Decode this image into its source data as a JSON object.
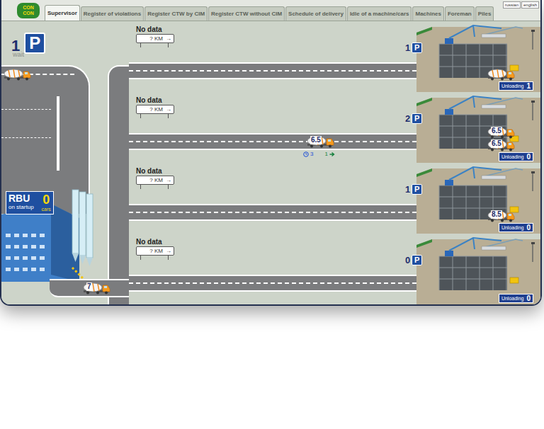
{
  "logo": [
    "CON",
    "CON"
  ],
  "tabs": [
    {
      "label": "Supervisor",
      "selected": true
    },
    {
      "label": "Register of violations",
      "selected": false
    },
    {
      "label": "Register CTW by CIM",
      "selected": false
    },
    {
      "label": "Register CTW without CIM",
      "selected": false
    },
    {
      "label": "Schedule of delivery",
      "selected": false
    },
    {
      "label": "Idle of a machine/cars",
      "selected": false
    },
    {
      "label": "Machines",
      "selected": false
    },
    {
      "label": "Foreman",
      "selected": false
    },
    {
      "label": "Piles",
      "selected": false
    }
  ],
  "languages": [
    "russian",
    "english"
  ],
  "parking": {
    "count": "1",
    "icon": "P",
    "label": "wait",
    "trucks": [
      {
        "load": null
      }
    ]
  },
  "plant": {
    "name": "RBU",
    "status": "on startup",
    "count": "0",
    "unit": "cars",
    "trucks": [
      {
        "load": "7"
      }
    ]
  },
  "lanes": [
    {
      "sign": {
        "title": "No data",
        "distance": "? KM",
        "arrow": "→"
      },
      "road_trucks": [],
      "site": {
        "parked": "1",
        "icon": "P",
        "unloading_label": "Unloading",
        "unloading": "1",
        "trucks": [
          {
            "load": null
          }
        ]
      }
    },
    {
      "sign": {
        "title": "No data",
        "distance": "? KM",
        "arrow": "→"
      },
      "road_trucks": [
        {
          "load": "6.5",
          "wait": "3",
          "queue": "1"
        }
      ],
      "site": {
        "parked": "2",
        "icon": "P",
        "unloading_label": "Unloading",
        "unloading": "0",
        "trucks": [
          {
            "load": "6.5"
          },
          {
            "load": "6.5"
          }
        ]
      }
    },
    {
      "sign": {
        "title": "No data",
        "distance": "? KM",
        "arrow": "→"
      },
      "road_trucks": [],
      "site": {
        "parked": "1",
        "icon": "P",
        "unloading_label": "Unloading",
        "unloading": "0",
        "trucks": [
          {
            "load": "8.5"
          }
        ]
      }
    },
    {
      "sign": {
        "title": "No data",
        "distance": "? KM",
        "arrow": "→"
      },
      "road_trucks": [],
      "site": {
        "parked": "0",
        "icon": "P",
        "unloading_label": "Unloading",
        "unloading": "0",
        "trucks": []
      }
    }
  ]
}
